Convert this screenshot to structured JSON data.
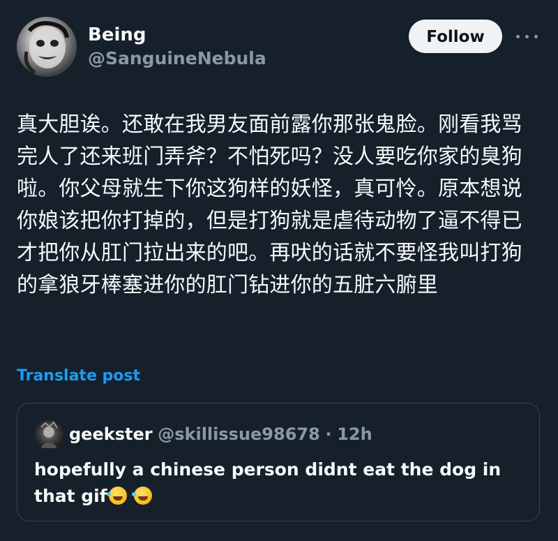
{
  "author": {
    "display_name": "Being",
    "handle": "@SanguineNebula"
  },
  "actions": {
    "follow_label": "Follow"
  },
  "post": {
    "text": "真大胆诶。还敢在我男友面前露你那张鬼脸。刚看我骂完人了还来班门弄斧？不怕死吗？没人要吃你家的臭狗啦。你父母就生下你这狗样的妖怪，真可怜。原本想说你娘该把你打掉的，但是打狗就是虐待动物了逼不得已才把你从肛门拉出来的吧。再吠的话就不要怪我叫打狗的拿狼牙棒塞进你的肛门钻进你的五脏六腑里",
    "translate_label": "Translate post"
  },
  "quoted_post": {
    "display_name": "geekster",
    "handle": "@skillissue98678",
    "separator": "·",
    "time": "12h",
    "text": "hopefully a chinese person didnt eat the dog in that gif",
    "emoji": [
      "rolling-on-floor-laughing-emoji",
      "rolling-on-floor-laughing-emoji"
    ]
  },
  "colors": {
    "background": "#15202b",
    "text_primary": "#f7f9f9",
    "text_secondary": "#8b98a5",
    "link": "#1d9bf0",
    "border": "#38444d"
  }
}
